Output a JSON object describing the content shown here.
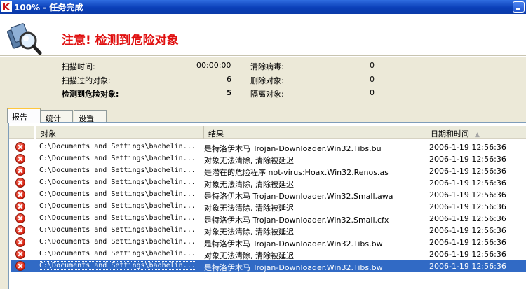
{
  "window": {
    "title": "100% - 任务完成",
    "minimize_label": ""
  },
  "header": {
    "warning": "注意! 检测到危险对象",
    "icon": "magnifier-scan-icon"
  },
  "stats": {
    "scan_time_label": "扫描时间:",
    "scan_time_value": "00:00:00",
    "scanned_label": "扫描过的对象:",
    "scanned_value": "6",
    "detected_label": "检测到危险对象:",
    "detected_value": "5",
    "cleaned_label": "清除病毒:",
    "cleaned_value": "0",
    "deleted_label": "删除对象:",
    "deleted_value": "0",
    "quarantined_label": "隔离对象:",
    "quarantined_value": "0"
  },
  "tabs": [
    "报告",
    "统计",
    "设置"
  ],
  "table": {
    "columns": [
      "对象",
      "结果",
      "日期和时间"
    ],
    "rows": [
      {
        "object": "C:\\Documents and Settings\\baohelin...",
        "result": "是特洛伊木马 Trojan-Downloader.Win32.Tibs.bu",
        "date": "2006-1-19 12:56:36"
      },
      {
        "object": "C:\\Documents and Settings\\baohelin...",
        "result": "对象无法清除, 清除被延迟",
        "date": "2006-1-19 12:56:36"
      },
      {
        "object": "C:\\Documents and Settings\\baohelin...",
        "result": "是潜在的危险程序 not-virus:Hoax.Win32.Renos.as",
        "date": "2006-1-19 12:56:36"
      },
      {
        "object": "C:\\Documents and Settings\\baohelin...",
        "result": "对象无法清除, 清除被延迟",
        "date": "2006-1-19 12:56:36"
      },
      {
        "object": "C:\\Documents and Settings\\baohelin...",
        "result": "是特洛伊木马 Trojan-Downloader.Win32.Small.awa",
        "date": "2006-1-19 12:56:36"
      },
      {
        "object": "C:\\Documents and Settings\\baohelin...",
        "result": "对象无法清除, 清除被延迟",
        "date": "2006-1-19 12:56:36"
      },
      {
        "object": "C:\\Documents and Settings\\baohelin...",
        "result": "是特洛伊木马 Trojan-Downloader.Win32.Small.cfx",
        "date": "2006-1-19 12:56:36"
      },
      {
        "object": "C:\\Documents and Settings\\baohelin...",
        "result": "对象无法清除, 清除被延迟",
        "date": "2006-1-19 12:56:36"
      },
      {
        "object": "C:\\Documents and Settings\\baohelin...",
        "result": "是特洛伊木马 Trojan-Downloader.Win32.Tibs.bw",
        "date": "2006-1-19 12:56:36"
      },
      {
        "object": "C:\\Documents and Settings\\baohelin...",
        "result": "对象无法清除, 清除被延迟",
        "date": "2006-1-19 12:56:36"
      },
      {
        "object": "C:\\Documents and Settings\\baohelin...",
        "result": "是特洛伊木马 Trojan-Downloader.Win32.Tibs.bw",
        "date": "2006-1-19 12:56:36"
      }
    ]
  },
  "colors": {
    "warning": "#e01010",
    "selection": "#316ac5",
    "titlebar": "#0a3fb8"
  }
}
